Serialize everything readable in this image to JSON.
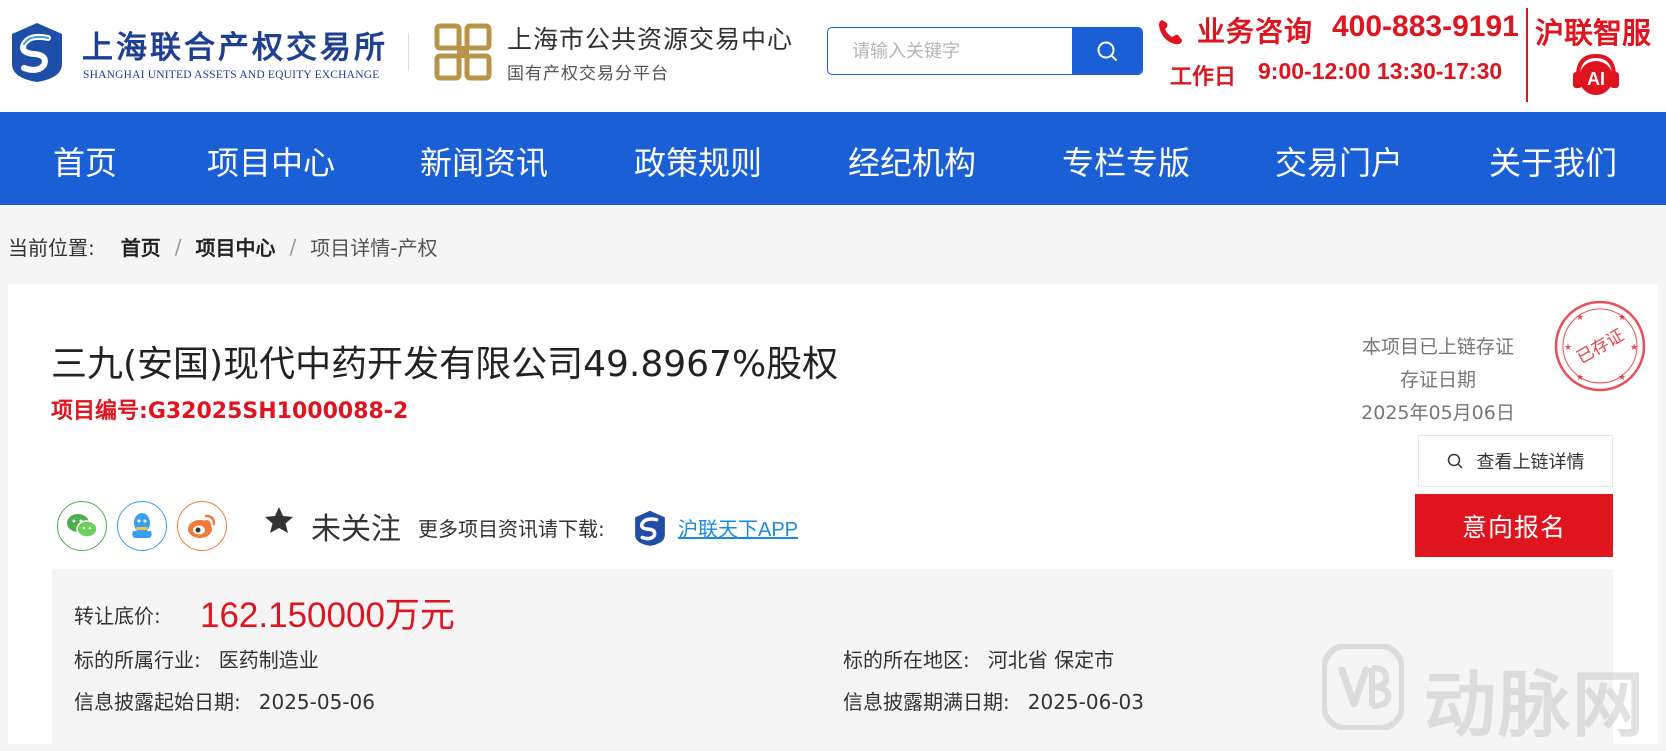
{
  "header": {
    "logo_cn": "上海联合产权交易所",
    "logo_en": "SHANGHAI UNITED ASSETS AND EQUITY EXCHANGE",
    "center_title": "上海市公共资源交易中心",
    "center_subtitle": "国有产权交易分平台",
    "search_placeholder": "请输入关键字",
    "hotline_label": "业务咨询",
    "hotline_number": "400-883-9191",
    "hours_label": "工作日",
    "hours_value": "9:00-12:00 13:30-17:30",
    "zhinao_title": "沪联智服",
    "ai_icon_text": "AI",
    "brand_red": "#e0141e",
    "brand_blue": "#1a5fd6"
  },
  "nav": {
    "items": [
      "首页",
      "项目中心",
      "新闻资讯",
      "政策规则",
      "经纪机构",
      "专栏专版",
      "交易门户",
      "关于我们"
    ]
  },
  "breadcrumb": {
    "label": "当前位置:",
    "items": [
      "首页",
      "项目中心",
      "项目详情-产权"
    ],
    "separator": "/"
  },
  "project": {
    "title": "三九(安国)现代中药开发有限公司49.8967%股权",
    "code_label": "项目编号:",
    "code_value": "G32025SH1000088-2",
    "chain_status": "本项目已上链存证",
    "chain_date_label": "存证日期",
    "chain_date": "2025年05月06日",
    "stamp_text": "已存证",
    "chain_button": "查看上链详情",
    "apply_button": "意向报名",
    "follow_label": "未关注",
    "download_hint": "更多项目资讯请下载:",
    "app_link": "沪联天下APP",
    "share_icons": [
      "wechat-icon",
      "qq-icon",
      "weibo-icon"
    ]
  },
  "info": {
    "price_label": "转让底价:",
    "price_value": "162.150000万元",
    "industry_label": "标的所属行业:",
    "industry_value": "医药制造业",
    "region_label": "标的所在地区:",
    "region_value": "河北省 保定市",
    "start_label": "信息披露起始日期:",
    "start_value": "2025-05-06",
    "end_label": "信息披露期满日期:",
    "end_value": "2025-06-03"
  },
  "watermark": {
    "text": "动脉网"
  }
}
